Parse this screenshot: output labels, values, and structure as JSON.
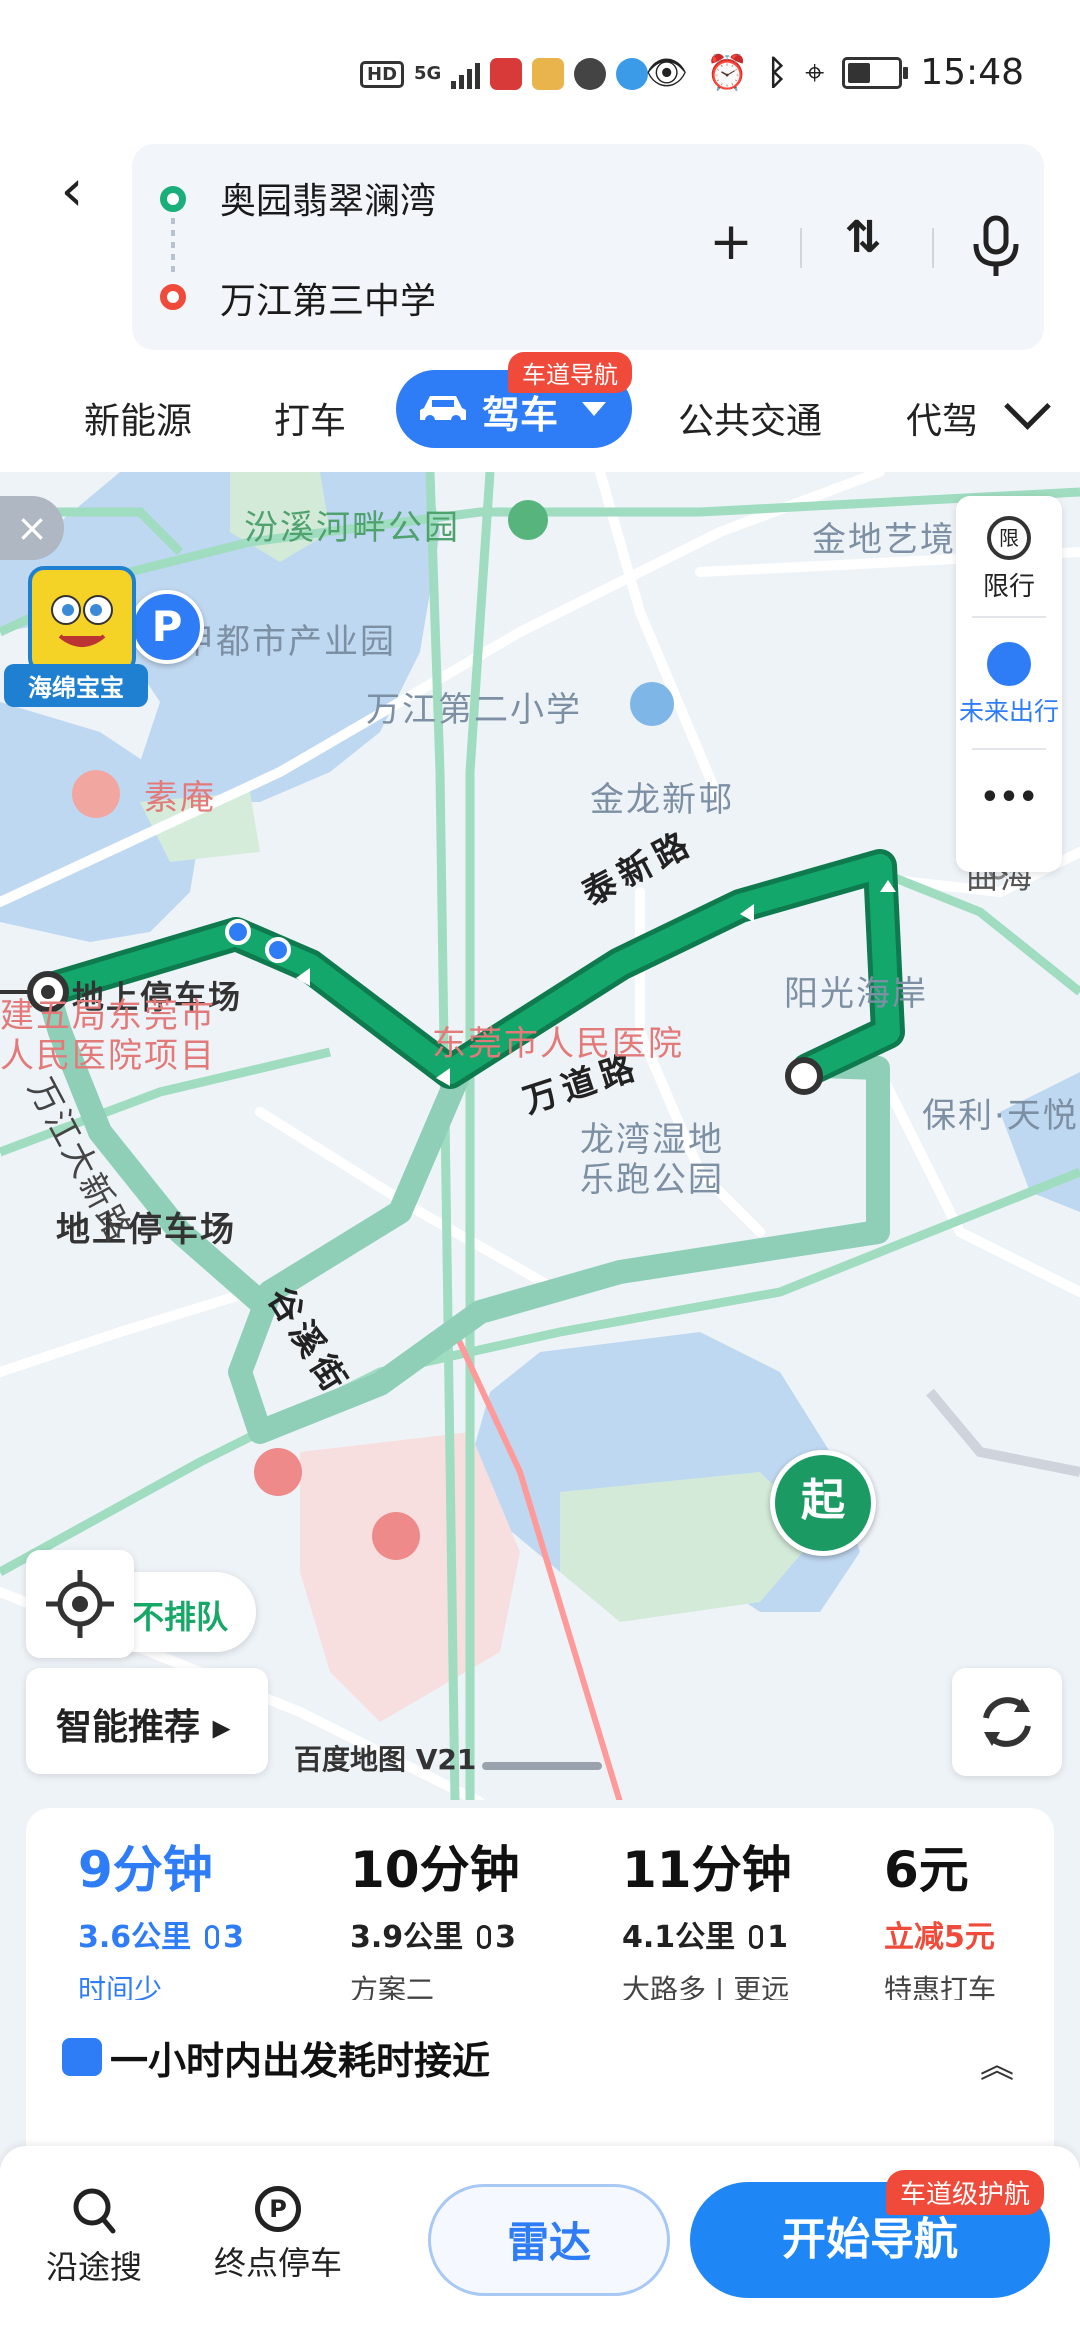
{
  "status_bar": {
    "network_badge": "HD",
    "network_type": "5G",
    "time": "15:48"
  },
  "route": {
    "origin": "奥园翡翠澜湾",
    "destination": "万江第三中学"
  },
  "mode_tabs": {
    "items": [
      "新能源",
      "打车",
      "驾车",
      "公共交通",
      "代驾"
    ],
    "selected": "驾车",
    "lane_badge": "车道导航"
  },
  "map": {
    "close_label": "×",
    "promo_label": "海绵宝宝",
    "labels": {
      "park": "汾溪河畔公园",
      "jindi": "金地艺境",
      "shangjia": "尚甲都市产业园",
      "suan": "素庵",
      "school2": "万江第二小学",
      "taixin_road": "泰新路",
      "parking_top": "地上停车场",
      "no_queue": "不排队",
      "parking_bottom": "地上停车场",
      "jinlong": "金龙新邨",
      "quhai": "曲海",
      "wandao_road": "万道路",
      "guxi_street": "谷溪街",
      "yangguang": "阳光海岸",
      "project_line1": "建五局东莞市",
      "project_line2": "人民医院项目",
      "hospital": "东莞市人民医院",
      "longwan_line1": "龙湾湿地",
      "longwan_line2": "乐跑公园",
      "poly": "保利·天悦",
      "start_pin": "起",
      "parking_icon": "P",
      "road_partial": "万江大新路"
    },
    "side_panel": {
      "restrict_icon": "限",
      "restrict_label": "限行",
      "future_label": "未来出行",
      "more_label": "•••"
    },
    "smart_recommend": "智能推荐 ▸",
    "logo": "百度地图 V21"
  },
  "route_options": [
    {
      "time": "9分钟",
      "distance": "3.6公里",
      "lights": "3",
      "tag": "时间少",
      "selected": true
    },
    {
      "time": "10分钟",
      "distance": "3.9公里",
      "lights": "3",
      "tag": "方案二",
      "selected": false
    },
    {
      "time": "11分钟",
      "distance": "4.1公里",
      "lights": "1",
      "tag": "大路多 | 更远",
      "selected": false
    },
    {
      "time": "6元",
      "discount": "立减5元",
      "tag": "特惠打车",
      "selected": false
    }
  ],
  "departure_hint": "一小时内出发耗时接近",
  "bottom_bar": {
    "along_search": "沿途搜",
    "end_parking": "终点停车",
    "parking_icon": "P",
    "radar": "雷达",
    "start_nav": "开始导航",
    "guard_badge": "车道级护航"
  },
  "colors": {
    "accent_blue": "#2e7cf6",
    "route_green": "#14a76c",
    "alt_route": "#8fcfb8",
    "alert_red": "#f04a3a"
  }
}
